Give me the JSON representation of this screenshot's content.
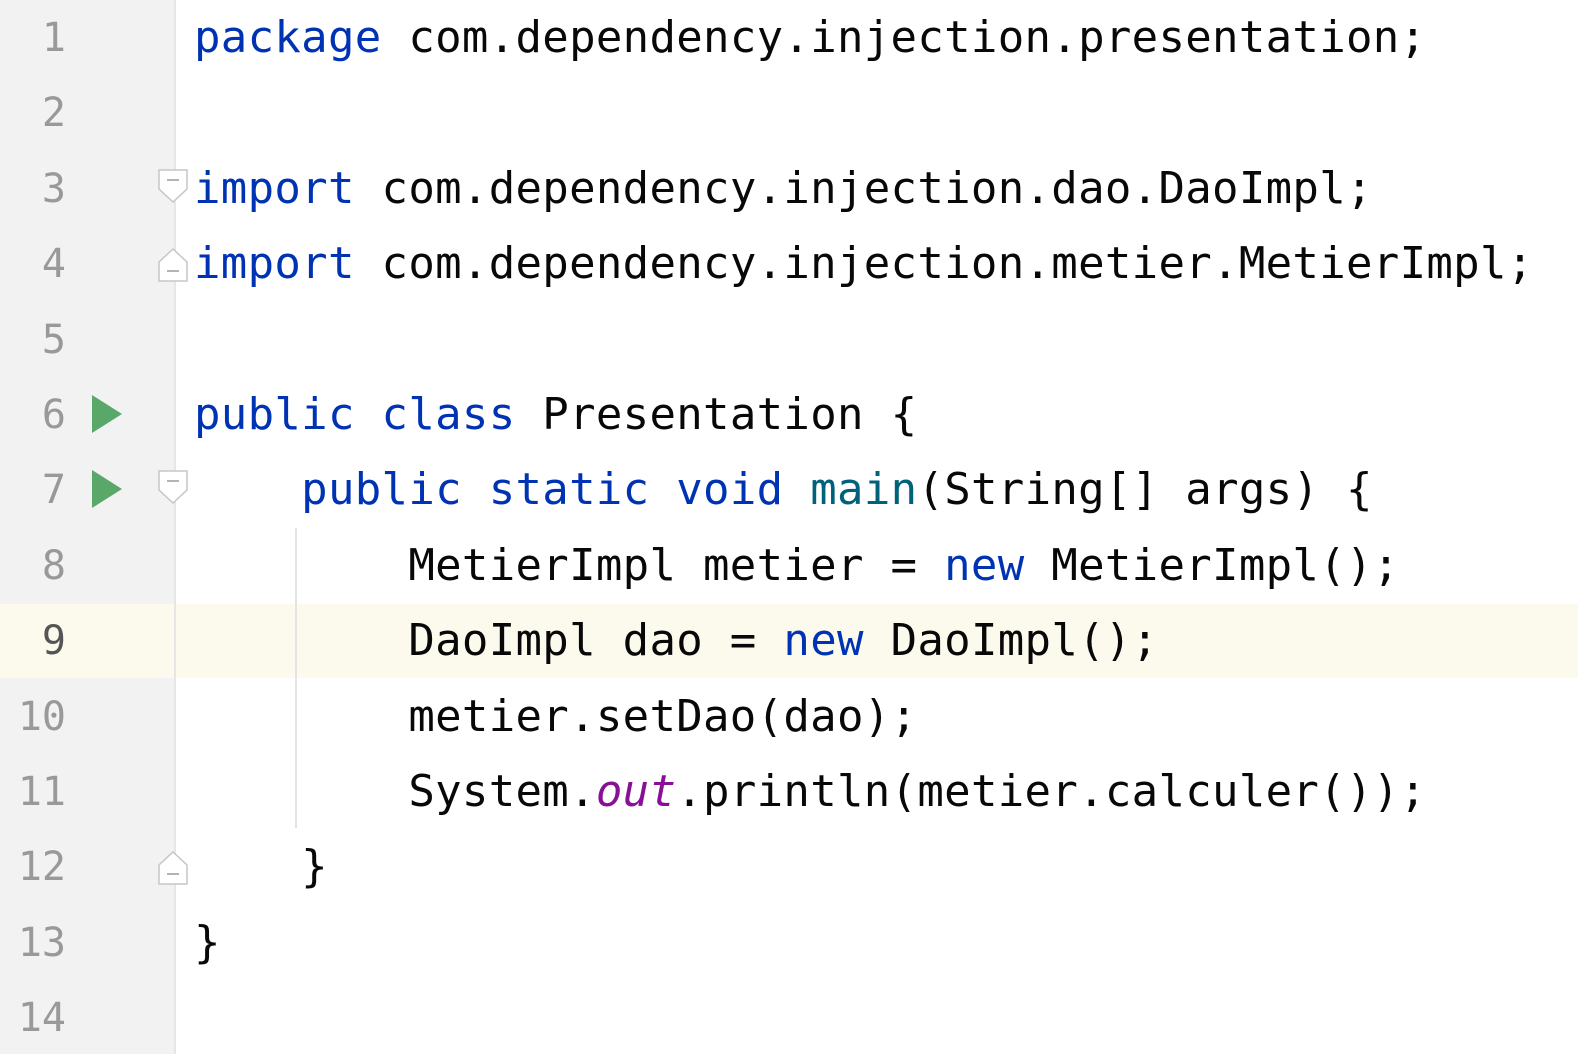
{
  "editor": {
    "caret_line": 9,
    "colors": {
      "keyword": "#0033b3",
      "method_decl": "#00627a",
      "static_field": "#871094",
      "text": "#080808",
      "gutter_bg": "#f2f2f2",
      "caret_line_bg": "#fcfaed",
      "run_icon": "#59a869"
    },
    "lines": [
      {
        "n": "1",
        "indent": "",
        "tokens": [
          {
            "t": "package",
            "k": "kw"
          },
          {
            "t": " com.dependency.injection.presentation;",
            "k": ""
          }
        ]
      },
      {
        "n": "2",
        "indent": "",
        "tokens": []
      },
      {
        "n": "3",
        "indent": "",
        "fold": "start",
        "tokens": [
          {
            "t": "import",
            "k": "kw"
          },
          {
            "t": " com.dependency.injection.dao.DaoImpl;",
            "k": ""
          }
        ]
      },
      {
        "n": "4",
        "indent": "",
        "fold": "end",
        "tokens": [
          {
            "t": "import",
            "k": "kw"
          },
          {
            "t": " com.dependency.injection.metier.MetierImpl;",
            "k": ""
          }
        ]
      },
      {
        "n": "5",
        "indent": "",
        "tokens": []
      },
      {
        "n": "6",
        "indent": "",
        "run": true,
        "tokens": [
          {
            "t": "public",
            "k": "kw"
          },
          {
            "t": " ",
            "k": ""
          },
          {
            "t": "class",
            "k": "kw"
          },
          {
            "t": " Presentation {",
            "k": ""
          }
        ]
      },
      {
        "n": "7",
        "indent": "    ",
        "run": true,
        "fold": "start",
        "tokens": [
          {
            "t": "public",
            "k": "kw"
          },
          {
            "t": " ",
            "k": ""
          },
          {
            "t": "static",
            "k": "kw"
          },
          {
            "t": " ",
            "k": ""
          },
          {
            "t": "void",
            "k": "kw"
          },
          {
            "t": " ",
            "k": ""
          },
          {
            "t": "main",
            "k": "fn"
          },
          {
            "t": "(String[] args) {",
            "k": ""
          }
        ]
      },
      {
        "n": "8",
        "indent": "        ",
        "tokens": [
          {
            "t": "MetierImpl metier = ",
            "k": ""
          },
          {
            "t": "new",
            "k": "kw"
          },
          {
            "t": " MetierImpl();",
            "k": ""
          }
        ]
      },
      {
        "n": "9",
        "indent": "        ",
        "tokens": [
          {
            "t": "DaoImpl dao = ",
            "k": ""
          },
          {
            "t": "new",
            "k": "kw"
          },
          {
            "t": " DaoImpl();",
            "k": ""
          }
        ]
      },
      {
        "n": "10",
        "indent": "        ",
        "tokens": [
          {
            "t": "metier.setDao(dao);",
            "k": ""
          }
        ]
      },
      {
        "n": "11",
        "indent": "        ",
        "tokens": [
          {
            "t": "System.",
            "k": ""
          },
          {
            "t": "out",
            "k": "st"
          },
          {
            "t": ".println(metier.calculer());",
            "k": ""
          }
        ]
      },
      {
        "n": "12",
        "indent": "    ",
        "fold": "end",
        "tokens": [
          {
            "t": "}",
            "k": ""
          }
        ]
      },
      {
        "n": "13",
        "indent": "",
        "tokens": [
          {
            "t": "}",
            "k": ""
          }
        ]
      },
      {
        "n": "14",
        "indent": "",
        "tokens": []
      }
    ]
  }
}
